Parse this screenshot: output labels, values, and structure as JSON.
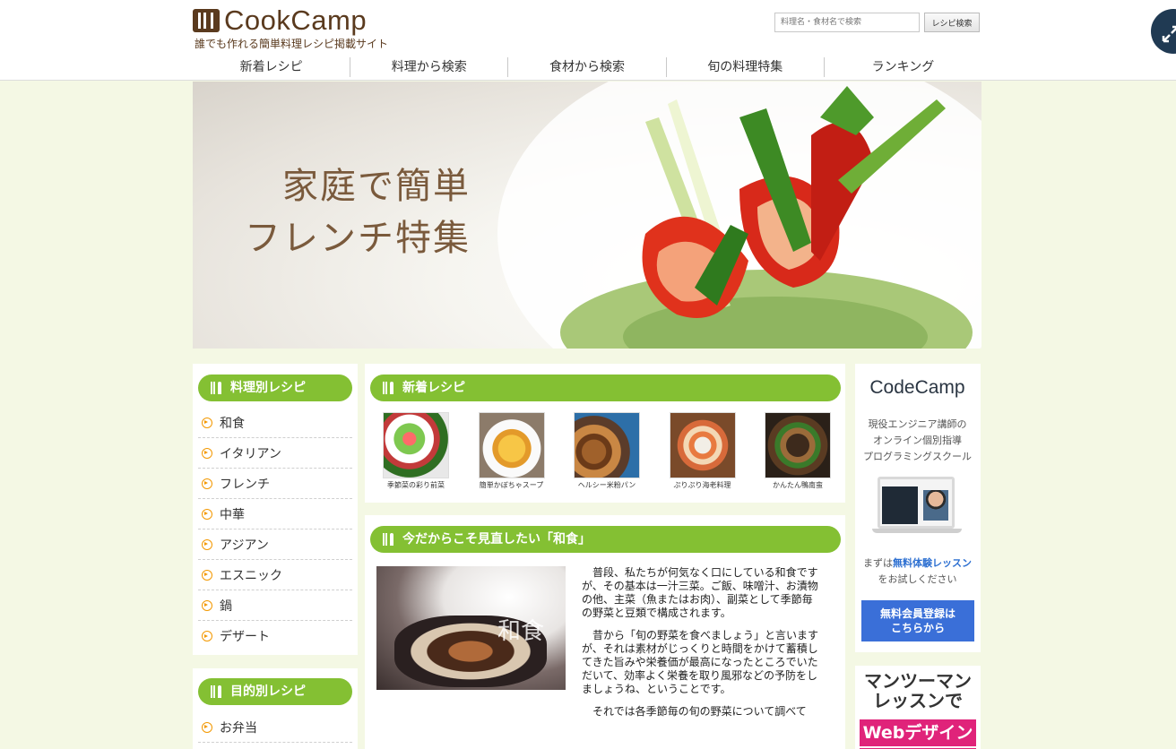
{
  "brand": {
    "logo_text": "CookCamp",
    "tagline": "誰でも作れる簡単料理レシピ掲載サイト"
  },
  "search": {
    "placeholder": "料理名・食材名で検索",
    "button_label": "レシピ検索"
  },
  "global_nav": [
    {
      "label": "新着レシピ"
    },
    {
      "label": "料理から検索"
    },
    {
      "label": "食材から検索"
    },
    {
      "label": "旬の料理特集"
    },
    {
      "label": "ランキング"
    }
  ],
  "hero": {
    "line1": "家庭で簡単",
    "line2": "フレンチ特集"
  },
  "sidebar": {
    "dish_section": {
      "title": "料理別レシピ",
      "items": [
        {
          "label": "和食"
        },
        {
          "label": "イタリアン"
        },
        {
          "label": "フレンチ"
        },
        {
          "label": "中華"
        },
        {
          "label": "アジアン"
        },
        {
          "label": "エスニック"
        },
        {
          "label": "鍋"
        },
        {
          "label": "デザート"
        }
      ]
    },
    "purpose_section": {
      "title": "目的別レシピ",
      "items": [
        {
          "label": "お弁当"
        }
      ]
    }
  },
  "new_recipes": {
    "title": "新着レシピ",
    "items": [
      {
        "caption": "季節菜の彩り前菜"
      },
      {
        "caption": "簡単かぼちゃスープ"
      },
      {
        "caption": "ヘルシー米粉パン"
      },
      {
        "caption": "ぷりぷり海老料理"
      },
      {
        "caption": "かんたん鴨南蛮"
      }
    ]
  },
  "washoku": {
    "title": "今だからこそ見直したい「和食」",
    "image_label": "和食",
    "paragraphs": [
      "普段、私たちが何気なく口にしている和食ですが、その基本は一汁三菜。ご飯、味噌汁、お漬物の他、主菜（魚またはお肉）、副菜として季節毎の野菜と豆類で構成されます。",
      "昔から「旬の野菜を食べましょう」と言いますが、それは素材がじっくりと時間をかけて蓄積してきた旨みや栄養価が最高になったところでいただいて、効率よく栄養を取り風邪などの予防をしましょうね、ということです。",
      "それでは各季節毎の旬の野菜について調べて"
    ]
  },
  "codecamp_ad": {
    "logo": "CodeCamp",
    "description_lines": [
      "現役エンジニア講師の",
      "オンライン個別指導",
      "プログラミングスクール"
    ],
    "trial_prefix": "まずは",
    "trial_highlight": "無料体験レッスン",
    "trial_suffix": "をお試しください",
    "button_line1": "無料会員登録は",
    "button_line2": "こちらから"
  },
  "mtm_ad": {
    "line1": "マンツーマン",
    "line2": "レッスンで",
    "band": "Webデザイン"
  },
  "colors": {
    "accent_green": "#84c033",
    "page_bg": "#f4f8e4",
    "brand_brown": "#5a3a1e",
    "bullet_orange": "#f39800",
    "cta_blue": "#3a6fd8",
    "ad_pink": "#e0237a"
  }
}
